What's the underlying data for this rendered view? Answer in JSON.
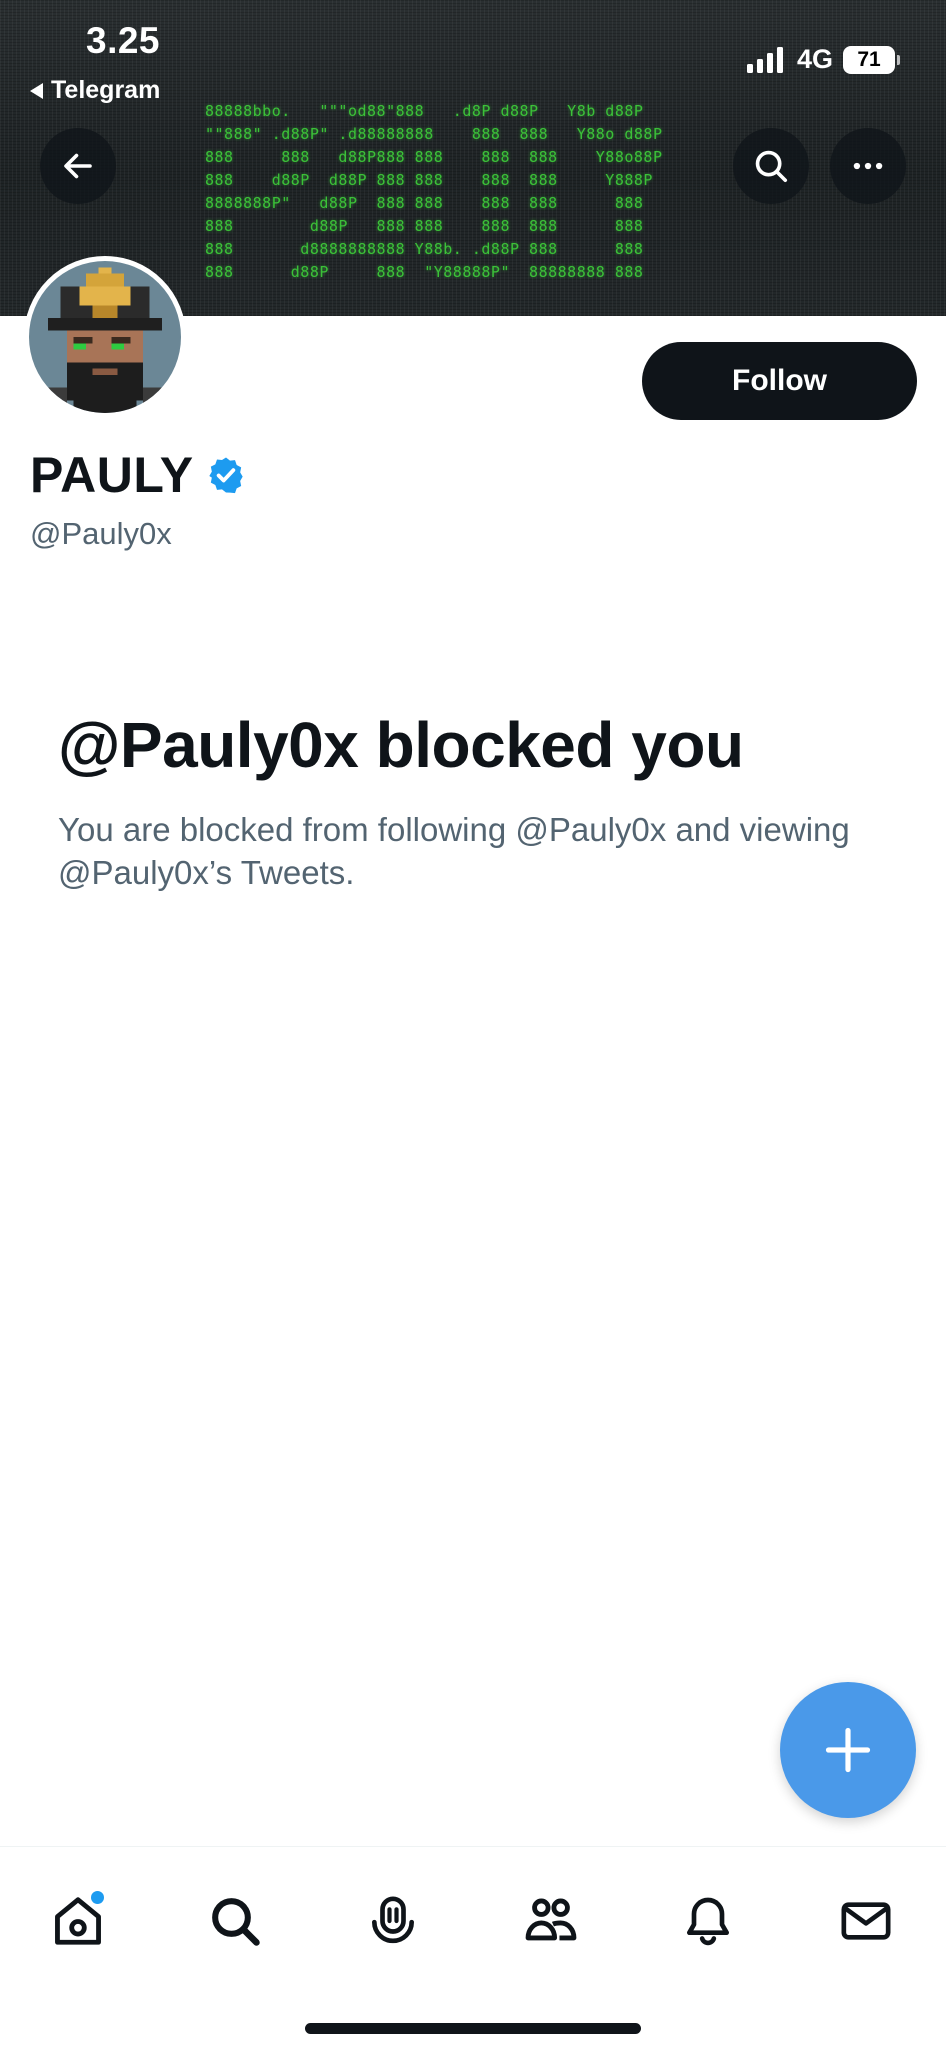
{
  "status_bar": {
    "time": "3.25",
    "back_app": "Telegram",
    "network": "4G",
    "battery": "71"
  },
  "banner": {
    "art_text": "88888bbo.   \"\"\"od88\"888   .d8P d88P   Y8b d88P\n\"\"888\" .d88P\" .d88888888    888  888   Y88o d88P\n888     888   d88P888 888    888  888    Y88o88P\n888    d88P  d88P 888 888    888  888     Y888P\n8888888P\"   d88P  888 888    888  888      888\n888        d88P   888 888    888  888      888\n888       d8888888888 Y88b. .d88P 888      888\n888      d88P     888  \"Y88888P\"  88888888 888"
  },
  "header_actions": {
    "back_icon": "arrow-left-icon",
    "search_icon": "search-icon",
    "more_icon": "ellipsis-icon"
  },
  "profile": {
    "display_name": "PAULY",
    "verified_icon": "verified-badge-icon",
    "handle": "@Pauly0x",
    "follow_label": "Follow"
  },
  "blocked": {
    "title": "@Pauly0x blocked you",
    "description": "You are blocked from following @Pauly0x and viewing @Pauly0x’s Tweets."
  },
  "fab": {
    "icon": "plus-icon"
  },
  "bottom_nav": {
    "items": [
      {
        "icon": "home-icon",
        "unread": true
      },
      {
        "icon": "search-icon",
        "unread": false
      },
      {
        "icon": "spaces-icon",
        "unread": false
      },
      {
        "icon": "communities-icon",
        "unread": false
      },
      {
        "icon": "notifications-icon",
        "unread": false
      },
      {
        "icon": "messages-icon",
        "unread": false
      }
    ]
  },
  "colors": {
    "primary_text": "#0f1419",
    "secondary_text": "#536471",
    "accent_blue": "#1d9bf0",
    "fab_blue": "#4a99e9",
    "banner_green": "#3ecf3a"
  }
}
